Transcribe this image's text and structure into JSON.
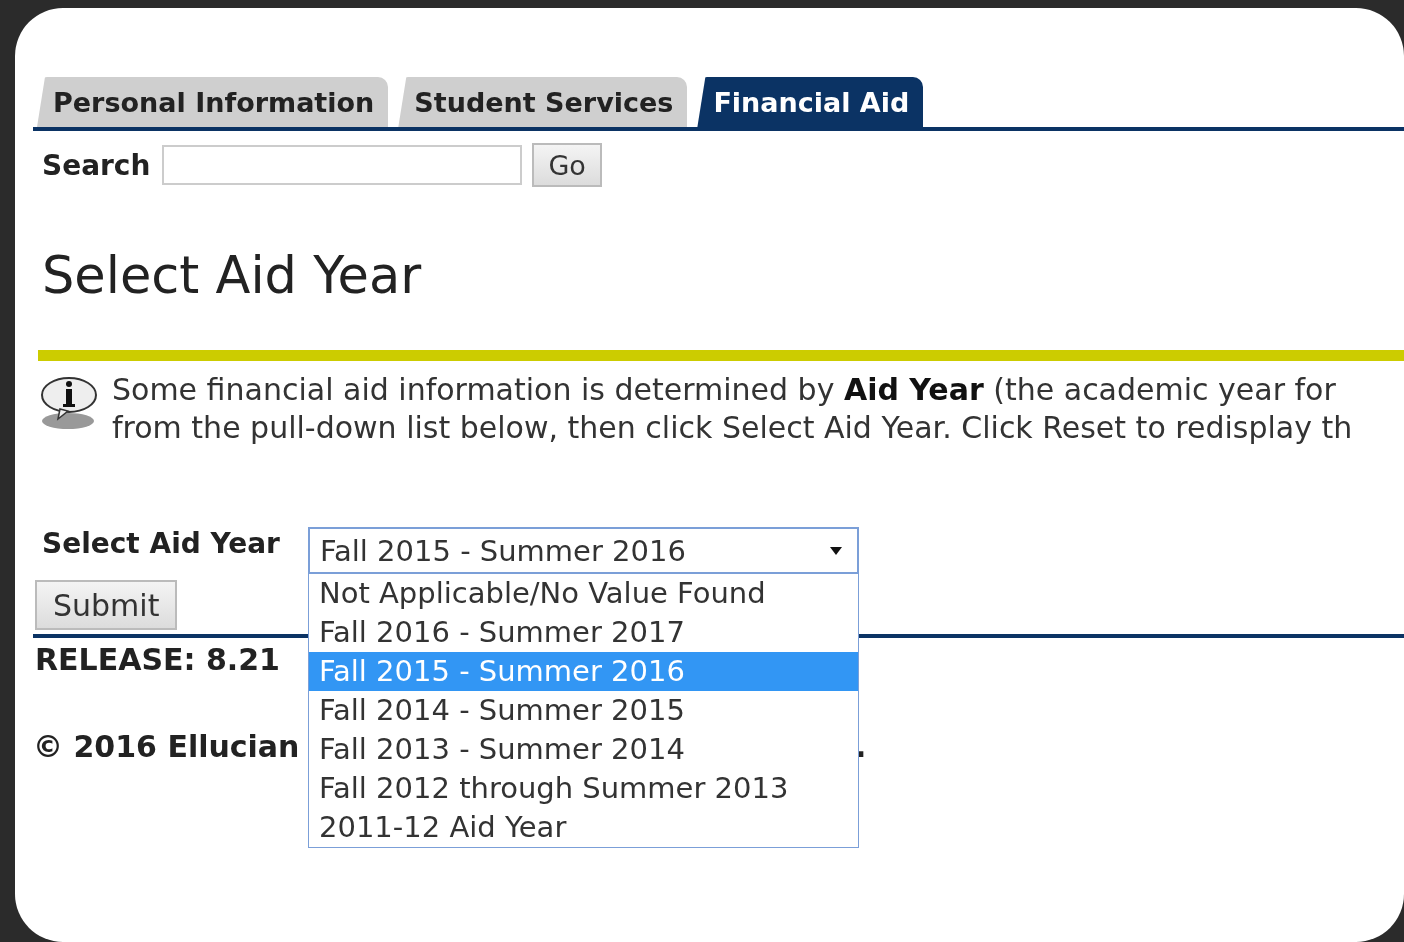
{
  "tabs": [
    {
      "label": "Personal Information",
      "selected": false
    },
    {
      "label": "Student Services",
      "selected": false
    },
    {
      "label": "Financial Aid",
      "selected": true
    }
  ],
  "search": {
    "label": "Search",
    "button": "Go"
  },
  "title": "Select Aid Year",
  "info": {
    "lines": [
      "Some financial aid information is determined by **Aid Year** (the academic year for",
      "from the pull-down list below, then click Select Aid Year. Click Reset to redisplay th"
    ]
  },
  "form": {
    "label": "Select Aid Year",
    "value": "Fall 2015 - Summer 2016",
    "expanded": true,
    "submit": "Submit",
    "options": [
      {
        "label": "Not Applicable/No Value Found",
        "selected": false
      },
      {
        "label": "Fall 2016 - Summer 2017",
        "selected": false
      },
      {
        "label": "Fall 2015 - Summer 2016",
        "selected": true
      },
      {
        "label": "Fall 2014 - Summer 2015",
        "selected": false
      },
      {
        "label": "Fall 2013 - Summer 2014",
        "selected": false
      },
      {
        "label": "Fall 2012 through Summer 2013",
        "selected": false
      },
      {
        "label": "2011-12 Aid Year",
        "selected": false
      }
    ]
  },
  "footer": {
    "release": "RELEASE: 8.21",
    "copyright": "© 2016 Ellucian",
    "copyright_end": "."
  }
}
